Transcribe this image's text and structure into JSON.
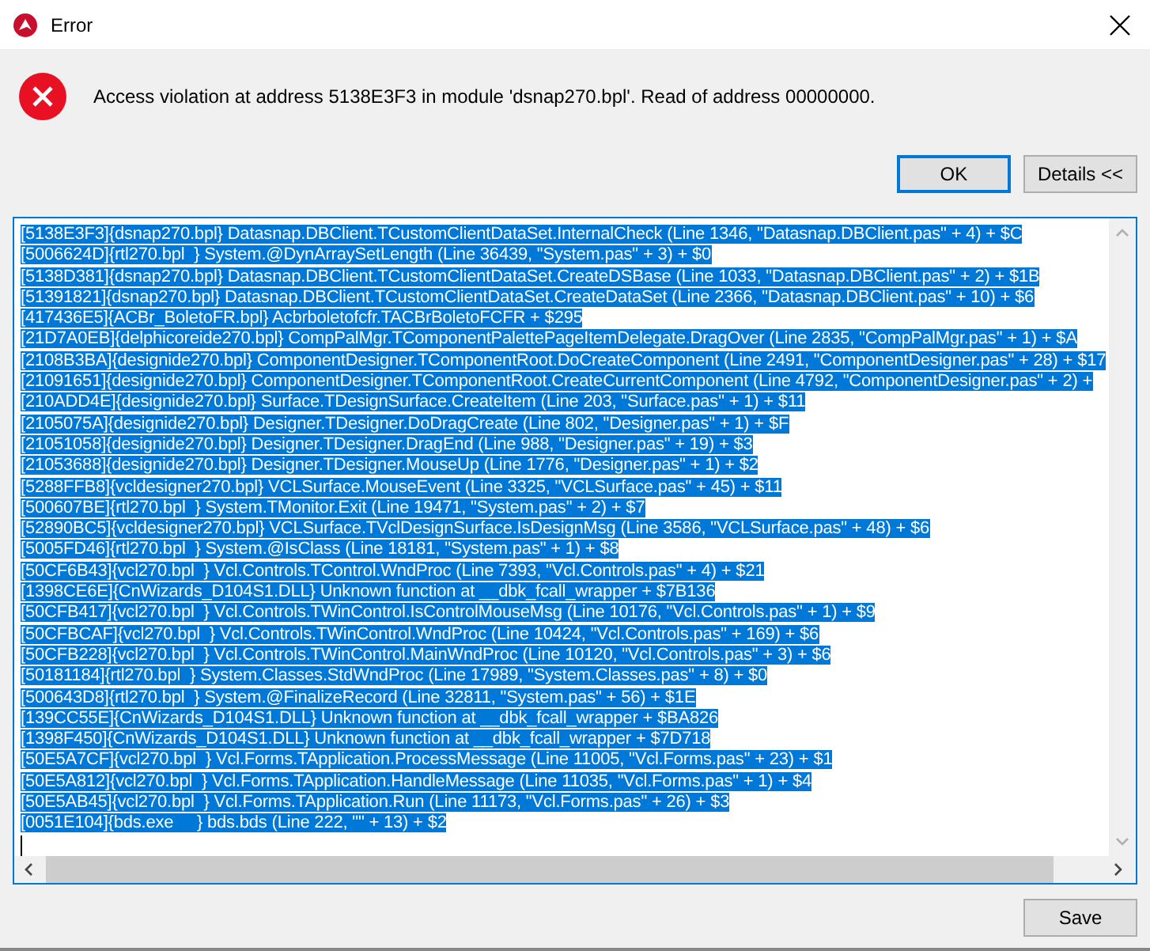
{
  "window": {
    "title": "Error"
  },
  "message": "Access violation at address 5138E3F3 in module 'dsnap270.bpl'. Read of address 00000000.",
  "buttons": [
    {
      "label": "OK",
      "default": true
    },
    {
      "label": "Details <<",
      "default": false
    }
  ],
  "details": {
    "selected": true,
    "lines": [
      "[5138E3F3]{dsnap270.bpl} Datasnap.DBClient.TCustomClientDataSet.InternalCheck (Line 1346, \"Datasnap.DBClient.pas\" + 4) + $C",
      "[5006624D]{rtl270.bpl  } System.@DynArraySetLength (Line 36439, \"System.pas\" + 3) + $0",
      "[5138D381]{dsnap270.bpl} Datasnap.DBClient.TCustomClientDataSet.CreateDSBase (Line 1033, \"Datasnap.DBClient.pas\" + 2) + $1B",
      "[51391821]{dsnap270.bpl} Datasnap.DBClient.TCustomClientDataSet.CreateDataSet (Line 2366, \"Datasnap.DBClient.pas\" + 10) + $6",
      "[417436E5]{ACBr_BoletoFR.bpl} Acbrboletofcfr.TACBrBoletoFCFR + $295",
      "[21D7A0EB]{delphicoreide270.bpl} CompPalMgr.TComponentPalettePageItemDelegate.DragOver (Line 2835, \"CompPalMgr.pas\" + 1) + $A",
      "[2108B3BA]{designide270.bpl} ComponentDesigner.TComponentRoot.DoCreateComponent (Line 2491, \"ComponentDesigner.pas\" + 28) + $17",
      "[21091651]{designide270.bpl} ComponentDesigner.TComponentRoot.CreateCurrentComponent (Line 4792, \"ComponentDesigner.pas\" + 2) +",
      "[210ADD4E]{designide270.bpl} Surface.TDesignSurface.CreateItem (Line 203, \"Surface.pas\" + 1) + $11",
      "[2105075A]{designide270.bpl} Designer.TDesigner.DoDragCreate (Line 802, \"Designer.pas\" + 1) + $F",
      "[21051058]{designide270.bpl} Designer.TDesigner.DragEnd (Line 988, \"Designer.pas\" + 19) + $3",
      "[21053688]{designide270.bpl} Designer.TDesigner.MouseUp (Line 1776, \"Designer.pas\" + 1) + $2",
      "[5288FFB8]{vcldesigner270.bpl} VCLSurface.MouseEvent (Line 3325, \"VCLSurface.pas\" + 45) + $11",
      "[500607BE]{rtl270.bpl  } System.TMonitor.Exit (Line 19471, \"System.pas\" + 2) + $7",
      "[52890BC5]{vcldesigner270.bpl} VCLSurface.TVclDesignSurface.IsDesignMsg (Line 3586, \"VCLSurface.pas\" + 48) + $6",
      "[5005FD46]{rtl270.bpl  } System.@IsClass (Line 18181, \"System.pas\" + 1) + $8",
      "[50CF6B43]{vcl270.bpl  } Vcl.Controls.TControl.WndProc (Line 7393, \"Vcl.Controls.pas\" + 4) + $21",
      "[1398CE6E]{CnWizards_D104S1.DLL} Unknown function at __dbk_fcall_wrapper + $7B136",
      "[50CFB417]{vcl270.bpl  } Vcl.Controls.TWinControl.IsControlMouseMsg (Line 10176, \"Vcl.Controls.pas\" + 1) + $9",
      "[50CFBCAF]{vcl270.bpl  } Vcl.Controls.TWinControl.WndProc (Line 10424, \"Vcl.Controls.pas\" + 169) + $6",
      "[50CFB228]{vcl270.bpl  } Vcl.Controls.TWinControl.MainWndProc (Line 10120, \"Vcl.Controls.pas\" + 3) + $6",
      "[50181184]{rtl270.bpl  } System.Classes.StdWndProc (Line 17989, \"System.Classes.pas\" + 8) + $0",
      "[500643D8]{rtl270.bpl  } System.@FinalizeRecord (Line 32811, \"System.pas\" + 56) + $1E",
      "[139CC55E]{CnWizards_D104S1.DLL} Unknown function at __dbk_fcall_wrapper + $BA826",
      "[1398F450]{CnWizards_D104S1.DLL} Unknown function at __dbk_fcall_wrapper + $7D718",
      "[50E5A7CF]{vcl270.bpl  } Vcl.Forms.TApplication.ProcessMessage (Line 11005, \"Vcl.Forms.pas\" + 23) + $1",
      "[50E5A812]{vcl270.bpl  } Vcl.Forms.TApplication.HandleMessage (Line 11035, \"Vcl.Forms.pas\" + 1) + $4",
      "[50E5AB45]{vcl270.bpl  } Vcl.Forms.TApplication.Run (Line 11173, \"Vcl.Forms.pas\" + 26) + $3",
      "[0051E104]{bds.exe     } bds.bds (Line 222, \"\" + 13) + $2"
    ]
  },
  "save_button": "Save"
}
